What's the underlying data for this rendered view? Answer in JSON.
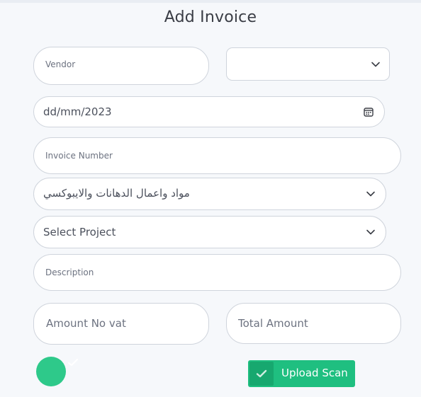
{
  "form": {
    "title": "Add Invoice",
    "vendor_placeholder": "Vendor",
    "vendor_select_value": "",
    "date_value": "dd/mm/2023",
    "invoice_number_placeholder": "Invoice Number",
    "category_value": "مواد واعمال الدهانات والايبوكسي",
    "project_value": "Select Project",
    "description_placeholder": "Description",
    "amount_no_vat_placeholder": "Amount No vat",
    "total_amount_placeholder": "Total Amount",
    "upload_label": "Upload Scan"
  },
  "colors": {
    "accent_green": "#1fbf80",
    "toggle_green": "#2ec98a"
  },
  "icons": [
    "chevron-down-icon",
    "calendar-icon",
    "check-icon"
  ]
}
